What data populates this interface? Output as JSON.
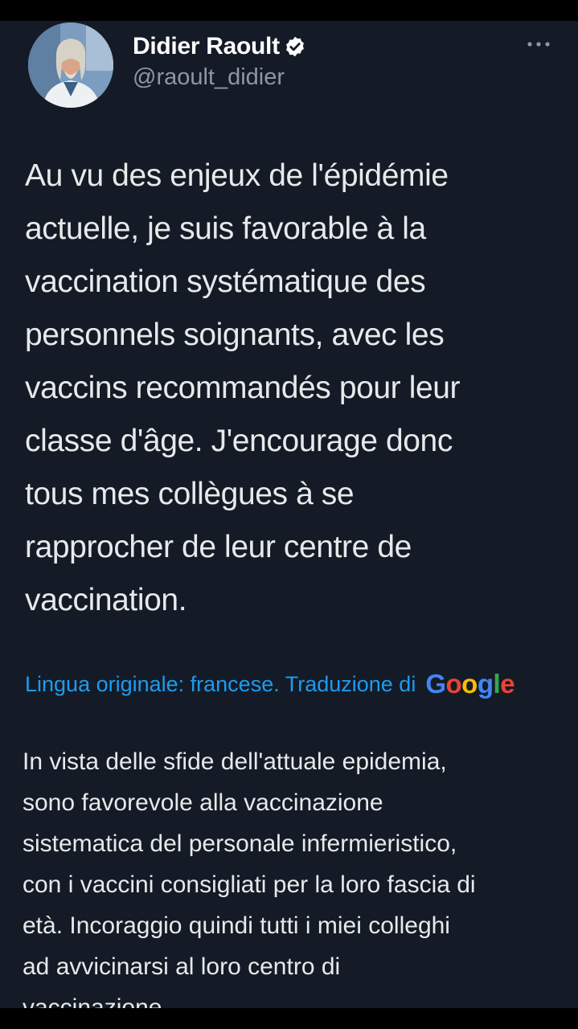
{
  "tweet": {
    "author": {
      "display_name": "Didier Raoult",
      "handle": "@raoult_didier",
      "verified": true,
      "avatar_icon": "author-photo"
    },
    "more_icon": "more-horizontal-icon",
    "text_lines": [
      "Au vu des enjeux de l'épidémie",
      "actuelle, je suis favorable à la",
      "vaccination systématique des",
      "personnels soignants, avec les",
      "vaccins recommandés pour leur",
      "classe d'âge. J'encourage donc",
      "tous mes collègues à se",
      "rapprocher de leur centre de",
      "vaccination."
    ],
    "translation_label": "Lingua originale: francese. Traduzione di",
    "translation_provider": "Google",
    "translation_lines": [
      "In vista delle sfide dell'attuale epidemia,",
      "sono favorevole alla vaccinazione",
      "sistematica del personale infermieristico,",
      "con i vaccini consigliati per la loro fascia di",
      "età. Incoraggio quindi tutti i miei colleghi",
      "ad avvicinarsi al loro centro di",
      "vaccinazione."
    ]
  },
  "colors": {
    "background": "#141b26",
    "text": "#e7e9ea",
    "secondary_text": "#8b98a5",
    "link": "#1d9bf0",
    "verified_badge": "#ffffff"
  }
}
